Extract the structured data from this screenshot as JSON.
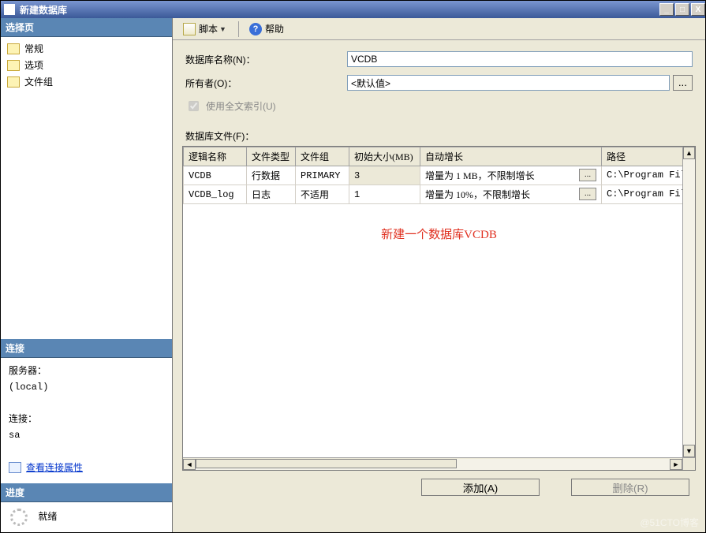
{
  "window": {
    "title": "新建数据库"
  },
  "titlebuttons": {
    "min": "_",
    "max": "□",
    "close": "X"
  },
  "sidebar": {
    "header_select": "选择页",
    "items": [
      {
        "label": "常规"
      },
      {
        "label": "选项"
      },
      {
        "label": "文件组"
      }
    ],
    "header_conn": "连接",
    "server_label": "服务器：",
    "server_value": "(local)",
    "conn_label": "连接：",
    "conn_value": "sa",
    "view_props": "查看连接属性",
    "header_prog": "进度",
    "progress": "就绪"
  },
  "toolbar": {
    "script": "脚本",
    "help": "帮助",
    "help_glyph": "?"
  },
  "form": {
    "dbname_label": "数据库名称(N)：",
    "dbname_value": "VCDB",
    "owner_label": "所有者(O)：",
    "owner_value": "<默认值>",
    "browse": "...",
    "fulltext_label": "使用全文索引(U)"
  },
  "filetable": {
    "caption": "数据库文件(F)：",
    "headers": {
      "logical": "逻辑名称",
      "ftype": "文件类型",
      "fgroup": "文件组",
      "initsize": "初始大小(MB)",
      "autogrow": "自动增长",
      "path": "路径"
    },
    "rows": [
      {
        "logical": "VCDB",
        "ftype": "行数据",
        "fgroup": "PRIMARY",
        "initsize": "3",
        "autogrow": "增量为 1 MB，不限制增长",
        "path": "C:\\Program Files\\Micr",
        "autogrow_btn": "...",
        "path_btn": "..."
      },
      {
        "logical": "VCDB_log",
        "ftype": "日志",
        "fgroup": "不适用",
        "initsize": "1",
        "autogrow": "增量为 10%，不限制增长",
        "path": "C:\\Program Files\\Micr",
        "autogrow_btn": "...",
        "path_btn": "..."
      }
    ]
  },
  "annotation": "新建一个数据库VCDB",
  "buttons": {
    "add": "添加(A)",
    "remove": "删除(R)"
  },
  "watermark": "@51CTO博客"
}
